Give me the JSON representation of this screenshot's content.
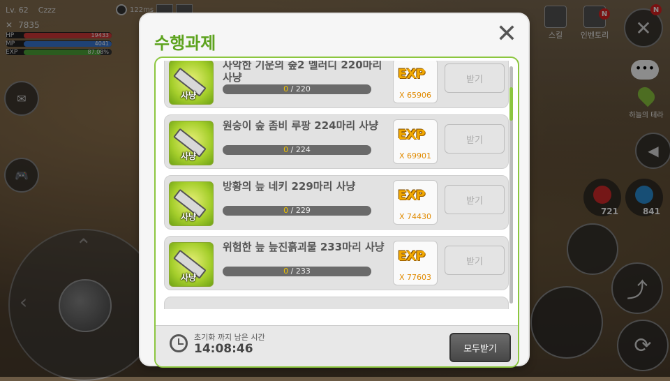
{
  "hud": {
    "level": "Lv. 62",
    "name": "Czzz",
    "power": "7835",
    "hp": {
      "label": "HP",
      "value": "19433",
      "fill": 1.0,
      "color": "#d63a3a"
    },
    "mp": {
      "label": "MP",
      "value": "4041",
      "fill": 1.0,
      "color": "#3a78d6"
    },
    "exp": {
      "label": "EXP",
      "value": "87.08%",
      "fill": 0.8708,
      "color": "#4fa83a"
    },
    "ping": "122ms"
  },
  "right_hud": {
    "skill_label": "스킬",
    "inventory_label": "인벤토리",
    "map_label": "하늘의 테라",
    "hp_potions": "721",
    "mp_potions": "841",
    "badge": "N"
  },
  "modal": {
    "title": "수행과제",
    "quests": [
      {
        "title": "사악한 기운의 숲2 멜러디 220마리 사냥",
        "tag": "사냥",
        "current": "0",
        "total": "/ 220",
        "reward_label": "EXP",
        "reward_amount": "X 65906",
        "claim_label": "받기"
      },
      {
        "title": "원숭이 숲 좀비 루팡 224마리 사냥",
        "tag": "사냥",
        "current": "0",
        "total": "/ 224",
        "reward_label": "EXP",
        "reward_amount": "X 69901",
        "claim_label": "받기"
      },
      {
        "title": "방황의 늪 네키 229마리 사냥",
        "tag": "사냥",
        "current": "0",
        "total": "/ 229",
        "reward_label": "EXP",
        "reward_amount": "X 74430",
        "claim_label": "받기"
      },
      {
        "title": "위험한 늪 늪진흙괴물 233마리 사냥",
        "tag": "사냥",
        "current": "0",
        "total": "/ 233",
        "reward_label": "EXP",
        "reward_amount": "X 77603",
        "claim_label": "받기"
      }
    ],
    "reset_label": "초기화 까지 남은 시간",
    "reset_time": "14:08:46",
    "claim_all_label": "모두받기"
  }
}
